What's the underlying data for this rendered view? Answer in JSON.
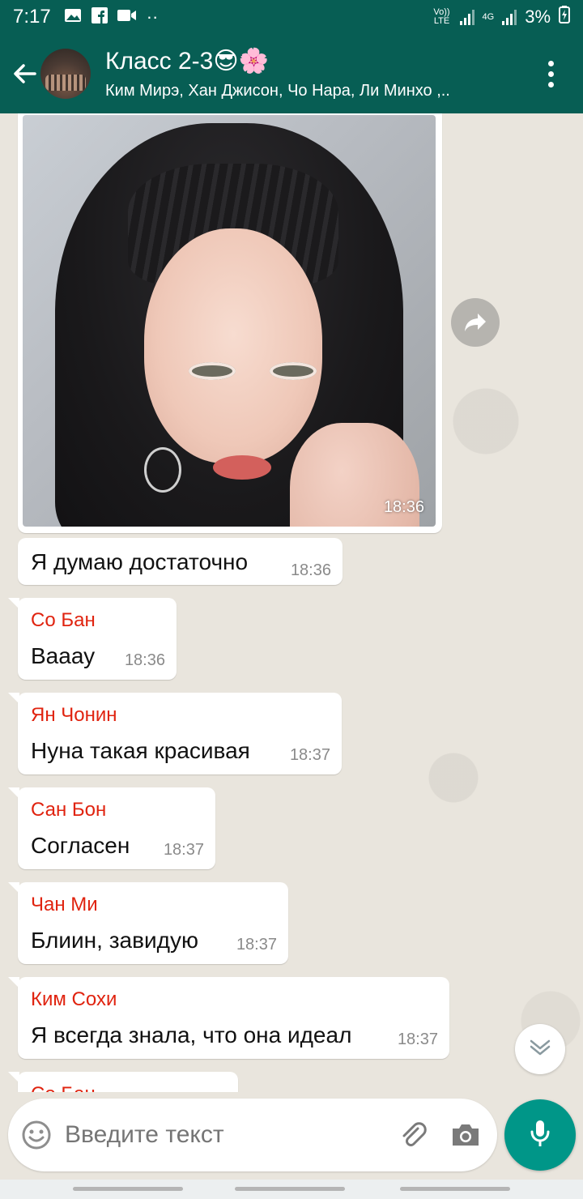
{
  "status_bar": {
    "time": "7:17",
    "volte": "Vo)) LTE",
    "net": "4G",
    "battery": "3%",
    "icons": [
      "gallery-icon",
      "facebook-icon",
      "video-icon",
      "more-dots-icon",
      "signal-icon",
      "battery-charging-icon"
    ]
  },
  "header": {
    "title": "Класс 2-3😎🌸",
    "subtitle": "Ким Мирэ, Хан Джисон, Чо Нара, Ли Минхо ,..",
    "icons": [
      "back-arrow-icon",
      "group-avatar",
      "more-vert-icon"
    ]
  },
  "photo_message": {
    "time": "18:36"
  },
  "messages": [
    {
      "sender": "",
      "text": "Я думаю достаточно",
      "time": "18:36"
    },
    {
      "sender": "Со Бан",
      "text": "Вааау",
      "time": "18:36"
    },
    {
      "sender": "Ян Чонин",
      "text": "Нуна такая красивая",
      "time": "18:37"
    },
    {
      "sender": "Сан Бон",
      "text": "Согласен",
      "time": "18:37"
    },
    {
      "sender": "Чан Ми",
      "text": "Блиин, завидую",
      "time": "18:37"
    },
    {
      "sender": "Ким Сохи",
      "text": "Я всегда знала, что она идеал",
      "time": "18:37"
    },
    {
      "sender": "Со Бан",
      "text": "",
      "time": ""
    }
  ],
  "input": {
    "placeholder": "Введите текст",
    "icons": [
      "emoji-icon",
      "attach-icon",
      "camera-icon",
      "mic-icon"
    ]
  },
  "colors": {
    "header": "#075e54",
    "accent": "#009688",
    "sender_name": "#e0230f",
    "chat_background": "#e9e5dd"
  }
}
